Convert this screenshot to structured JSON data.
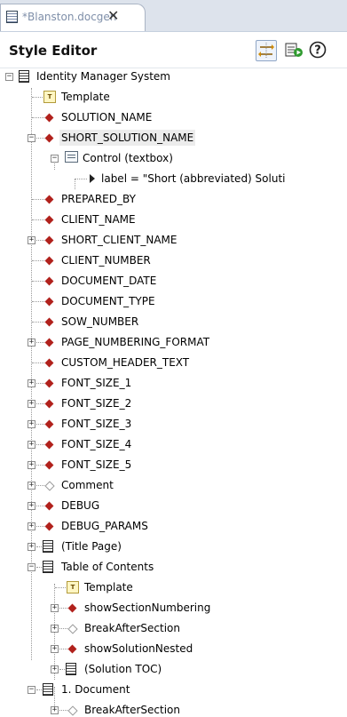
{
  "tab": {
    "title": "*Blanston.docgen",
    "close_glyph": "✕"
  },
  "header": {
    "title": "Style Editor",
    "help_glyph": "?"
  },
  "tree": {
    "items": [
      {
        "label": "Identity Manager System",
        "icon": "document-icon",
        "toggle": "−"
      },
      {
        "label": "Template",
        "icon": "template-icon",
        "toggle": ""
      },
      {
        "label": "SOLUTION_NAME",
        "icon": "diamond-icon",
        "toggle": ""
      },
      {
        "label": "SHORT_SOLUTION_NAME",
        "icon": "diamond-icon",
        "toggle": "−"
      },
      {
        "label": "Control (textbox)",
        "icon": "control-icon",
        "toggle": "−"
      },
      {
        "label": "label = \"Short (abbreviated) Soluti",
        "icon": "arrow-icon",
        "toggle": ""
      },
      {
        "label": "PREPARED_BY",
        "icon": "diamond-icon",
        "toggle": ""
      },
      {
        "label": "CLIENT_NAME",
        "icon": "diamond-icon",
        "toggle": ""
      },
      {
        "label": "SHORT_CLIENT_NAME",
        "icon": "diamond-icon",
        "toggle": "+"
      },
      {
        "label": "CLIENT_NUMBER",
        "icon": "diamond-icon",
        "toggle": ""
      },
      {
        "label": "DOCUMENT_DATE",
        "icon": "diamond-icon",
        "toggle": ""
      },
      {
        "label": "DOCUMENT_TYPE",
        "icon": "diamond-icon",
        "toggle": ""
      },
      {
        "label": "SOW_NUMBER",
        "icon": "diamond-icon",
        "toggle": ""
      },
      {
        "label": "PAGE_NUMBERING_FORMAT",
        "icon": "diamond-icon",
        "toggle": "+"
      },
      {
        "label": "CUSTOM_HEADER_TEXT",
        "icon": "diamond-icon",
        "toggle": ""
      },
      {
        "label": "FONT_SIZE_1",
        "icon": "diamond-icon",
        "toggle": "+"
      },
      {
        "label": "FONT_SIZE_2",
        "icon": "diamond-icon",
        "toggle": "+"
      },
      {
        "label": "FONT_SIZE_3",
        "icon": "diamond-icon",
        "toggle": "+"
      },
      {
        "label": "FONT_SIZE_4",
        "icon": "diamond-icon",
        "toggle": "+"
      },
      {
        "label": "FONT_SIZE_5",
        "icon": "diamond-icon",
        "toggle": "+"
      },
      {
        "label": "Comment",
        "icon": "hollow-diamond-icon",
        "toggle": "+"
      },
      {
        "label": "DEBUG",
        "icon": "diamond-icon",
        "toggle": "+"
      },
      {
        "label": "DEBUG_PARAMS",
        "icon": "diamond-icon",
        "toggle": "+"
      },
      {
        "label": "(Title Page)",
        "icon": "document-icon",
        "toggle": "+"
      },
      {
        "label": "Table of Contents",
        "icon": "document-icon",
        "toggle": "−"
      },
      {
        "label": "Template",
        "icon": "template-icon",
        "toggle": ""
      },
      {
        "label": "showSectionNumbering",
        "icon": "diamond-icon",
        "toggle": "+"
      },
      {
        "label": "BreakAfterSection",
        "icon": "hollow-diamond-icon",
        "toggle": "+"
      },
      {
        "label": "showSolutionNested",
        "icon": "diamond-icon",
        "toggle": "+"
      },
      {
        "label": "(Solution TOC)",
        "icon": "document-icon",
        "toggle": "+"
      },
      {
        "label": "1. Document",
        "icon": "document-icon",
        "toggle": "−"
      },
      {
        "label": "BreakAfterSection",
        "icon": "hollow-diamond-icon",
        "toggle": "+"
      }
    ]
  }
}
